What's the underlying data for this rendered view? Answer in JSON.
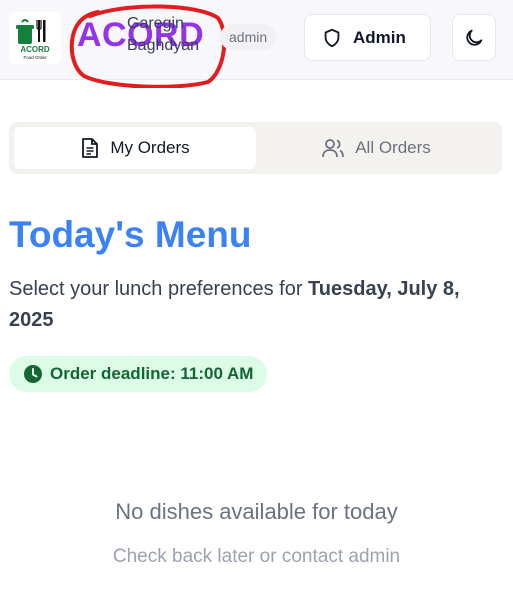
{
  "header": {
    "logo_text": "ACORD",
    "logo_subtext": "Food Order",
    "brand": "ACORD",
    "user_name": "Garegin Baghdyan",
    "role": "admin",
    "admin_button": "Admin",
    "theme_icon": "moon-icon"
  },
  "tabs": [
    {
      "label": "My Orders",
      "icon": "document-icon",
      "active": true
    },
    {
      "label": "All Orders",
      "icon": "users-icon",
      "active": false
    }
  ],
  "main": {
    "title": "Today's Menu",
    "subtitle_prefix": "Select your lunch preferences for ",
    "date": "Tuesday, July 8, 2025",
    "deadline": "Order deadline: 11:00 AM",
    "empty_title": "No dishes available for today",
    "empty_sub": "Check back later or contact admin"
  },
  "colors": {
    "brand": "#9333ea",
    "title": "#3b82f6",
    "deadline_bg": "#dcfce7",
    "deadline_text": "#166534",
    "annotation_circle": "#e11d1d"
  }
}
